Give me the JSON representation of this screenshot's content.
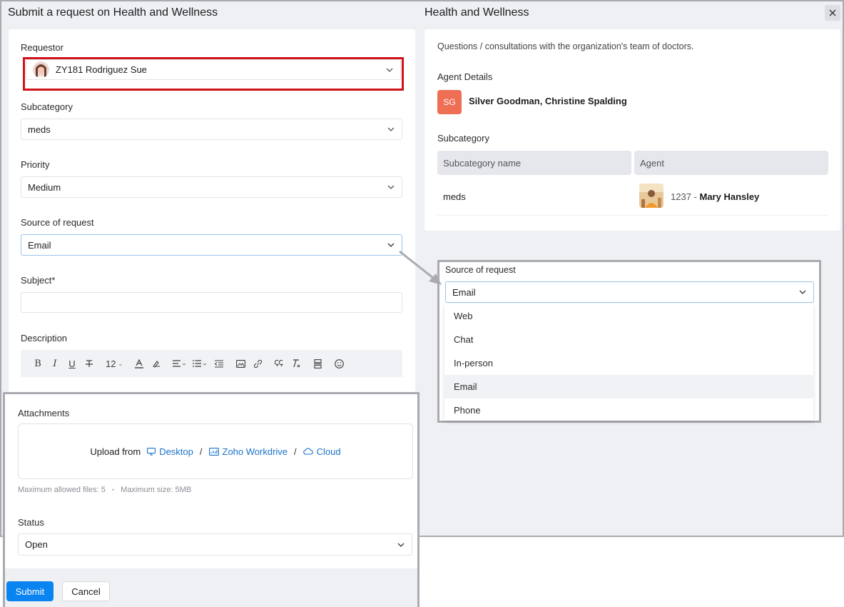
{
  "left_panel": {
    "title": "Submit a request on Health and Wellness",
    "requestor": {
      "label": "Requestor",
      "value": "ZY181 Rodriguez Sue"
    },
    "subcategory": {
      "label": "Subcategory",
      "value": "meds"
    },
    "priority": {
      "label": "Priority",
      "value": "Medium"
    },
    "source": {
      "label": "Source of request",
      "value": "Email"
    },
    "subject": {
      "label": "Subject*",
      "value": ""
    },
    "description": {
      "label": "Description",
      "font_size": "12"
    },
    "attachments": {
      "label": "Attachments",
      "upload_from": "Upload from",
      "desktop": "Desktop",
      "workdrive": "Zoho Workdrive",
      "cloud": "Cloud",
      "separator": "/",
      "max_files": "Maximum allowed files: 5",
      "dot": "•",
      "max_size": "Maximum size: 5MB"
    },
    "status": {
      "label": "Status",
      "value": "Open"
    },
    "buttons": {
      "submit": "Submit",
      "cancel": "Cancel"
    }
  },
  "right_panel": {
    "title": "Health and Wellness",
    "description": "Questions / consultations with the organization's team of doctors.",
    "agent_details_label": "Agent Details",
    "agent_initials": "SG",
    "agent_names": "Silver Goodman, Christine Spalding",
    "subcategory_label": "Subcategory",
    "table": {
      "headers": [
        "Subcategory name",
        "Agent"
      ],
      "row": {
        "name": "meds",
        "agent_id": "1237 - ",
        "agent_name": "Mary Hansley"
      }
    }
  },
  "source_dropdown": {
    "label": "Source of request",
    "value": "Email",
    "options": [
      "Web",
      "Chat",
      "In-person",
      "Email",
      "Phone"
    ],
    "selected": "Email"
  },
  "colors": {
    "primary": "#0a84f0",
    "link": "#1a73c9",
    "highlight_border": "#d0121b",
    "agent_badge": "#ef6f55"
  },
  "icons": {
    "close": "close-icon",
    "chevron": "chevron-down-icon",
    "desktop": "monitor-icon",
    "workdrive": "workdrive-icon",
    "cloud": "cloud-icon"
  }
}
